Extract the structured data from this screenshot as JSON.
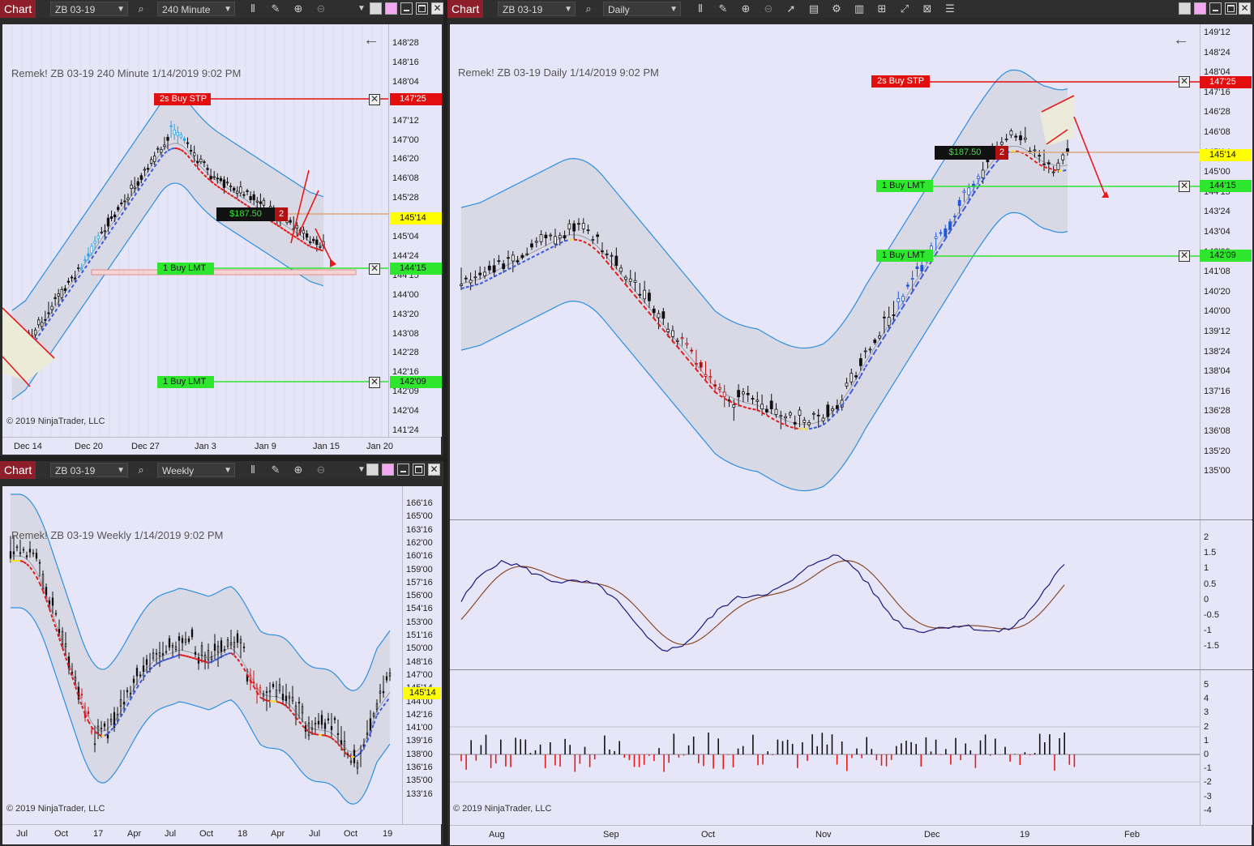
{
  "common": {
    "chart_tab": "Chart",
    "instrument": "ZB 03-19",
    "copyright": "© 2019 NinjaTrader, LLC",
    "pnl": "$187.50",
    "position_qty": "2",
    "current_price": "145'14"
  },
  "colors": {
    "title_tab": "#8e1f2a",
    "plot_bg": "#e6e6f8",
    "buy_stp": "#e30e0e",
    "buy_lmt": "#2ee62e",
    "price_tag": "#ffff00",
    "band": "#2b8fe0",
    "midline_up": "#3b5bd6",
    "midline_down": "#e31b1b",
    "midline_flat": "#f2e21b"
  },
  "win240": {
    "period": "240 Minute",
    "title": "Remek!  ZB 03-19  240 Minute  1/14/2019 9:02 PM",
    "yticks": [
      "148'28",
      "148'16",
      "148'04",
      "147'25",
      "147'12",
      "147'00",
      "146'20",
      "146'08",
      "145'28",
      "145'14",
      "145'04",
      "144'24",
      "144'15",
      "144'00",
      "143'20",
      "143'08",
      "142'28",
      "142'16",
      "142'09",
      "142'04",
      "141'24"
    ],
    "xticks": [
      "Dec 14",
      "Dec 20",
      "Dec 27",
      "Jan 3",
      "Jan 9",
      "Jan 15",
      "Jan 20"
    ],
    "orders": [
      {
        "label": "2s  Buy STP",
        "price": "147'25"
      },
      {
        "label": "1  Buy LMT",
        "price": "144'15"
      },
      {
        "label": "1  Buy LMT",
        "price": "142'09"
      }
    ]
  },
  "winDaily": {
    "period": "Daily",
    "title": "Remek!  ZB 03-19  Daily  1/14/2019 9:02 PM",
    "yticks": [
      "149'12",
      "148'24",
      "148'04",
      "147'16",
      "146'28",
      "146'08",
      "145'14",
      "145'00",
      "144'15",
      "143'24",
      "143'04",
      "142'09",
      "141'08",
      "140'20",
      "140'00",
      "139'12",
      "138'24",
      "138'04",
      "137'16",
      "136'28",
      "136'08",
      "135'20",
      "135'00"
    ],
    "xticks": [
      "Aug",
      "Sep",
      "Oct",
      "Nov",
      "Dec",
      "19",
      "Feb"
    ],
    "osc_ticks": [
      "2",
      "1.5",
      "1",
      "0.5",
      "0",
      "-0.5",
      "-1",
      "-1.5"
    ],
    "hist_ticks": [
      "5",
      "4",
      "3",
      "2",
      "1",
      "0",
      "-1",
      "-2",
      "-3",
      "-4"
    ],
    "orders": [
      {
        "label": "2s  Buy STP",
        "price": "147'25"
      },
      {
        "label": "1  Buy LMT",
        "price": "144'15"
      },
      {
        "label": "1  Buy LMT",
        "price": "142'09"
      }
    ]
  },
  "winWeekly": {
    "period": "Weekly",
    "title": "Remek!  ZB 03-19  Weekly  1/14/2019 9:02 PM",
    "yticks": [
      "166'16",
      "165'00",
      "163'16",
      "162'00",
      "160'16",
      "159'00",
      "157'16",
      "156'00",
      "154'16",
      "153'00",
      "151'16",
      "150'00",
      "148'16",
      "147'00",
      "145'14",
      "144'00",
      "142'16",
      "141'00",
      "139'16",
      "138'00",
      "136'16",
      "135'00",
      "133'16"
    ],
    "xticks": [
      "Jul",
      "Oct",
      "17",
      "Apr",
      "Jul",
      "Oct",
      "18",
      "Apr",
      "Jul",
      "Oct",
      "19"
    ]
  }
}
